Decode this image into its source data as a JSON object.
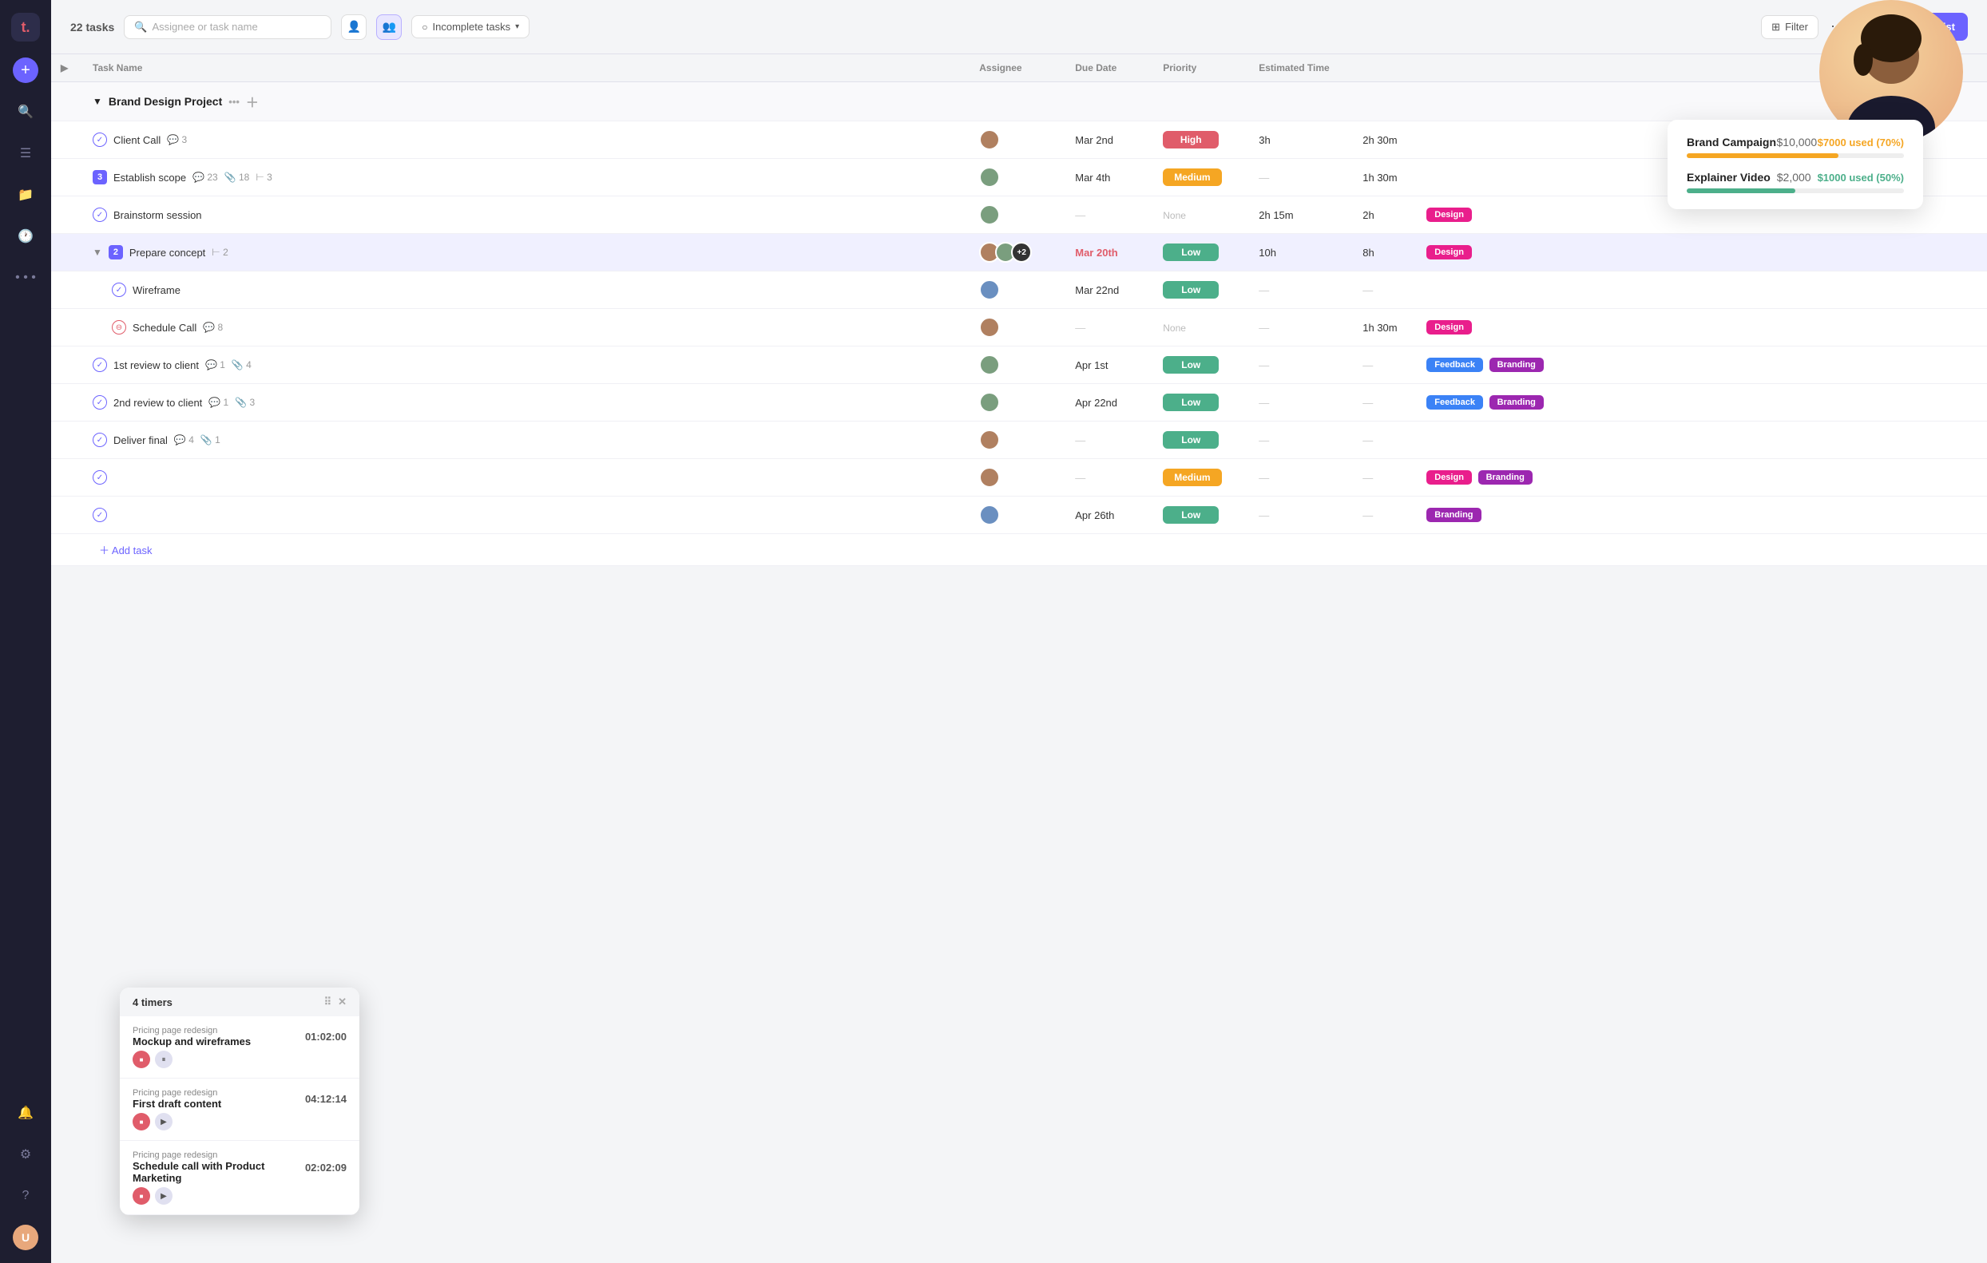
{
  "app": {
    "logo": "t.",
    "task_count": "22 tasks"
  },
  "header": {
    "search_placeholder": "Assignee or task name",
    "filter_label": "Incomplete tasks",
    "add_task_label": "+ Add task list",
    "more_icon": "⋯"
  },
  "budget_popup": {
    "items": [
      {
        "name": "Brand Campaign",
        "total": "$10,000",
        "used_label": "$7000 used",
        "used_pct": "(70%)",
        "bar_pct": 70,
        "bar_color": "yellow"
      },
      {
        "name": "Explainer Video",
        "total": "$2,000",
        "used_label": "$1000 used",
        "used_pct": "(50%)",
        "bar_pct": 50,
        "bar_color": "green"
      }
    ]
  },
  "columns": {
    "task_name": "Task Name",
    "assignee": "Assignee",
    "due_date": "Due Date",
    "priority": "Priority",
    "estimated_time": "Estimated Time",
    "c1": "",
    "c2": ""
  },
  "section": {
    "name": "Brand Design Project"
  },
  "tasks": [
    {
      "id": 1,
      "name": "Client Call",
      "check": "done",
      "comments": 3,
      "assignee_color": "#b08060",
      "due_date": "Mar 2nd",
      "priority": "High",
      "priority_class": "priority-high",
      "est": "3h",
      "time": "2h 30m",
      "tags": []
    },
    {
      "id": 2,
      "name": "Establish scope",
      "check": "expand",
      "expand_num": "3",
      "comments": 23,
      "attachments": 18,
      "subtasks": 3,
      "assignee_color": "#7a9e7e",
      "due_date": "Mar 4th",
      "priority": "Medium",
      "priority_class": "priority-medium",
      "est": "",
      "time": "1h 30m",
      "tags": []
    },
    {
      "id": 3,
      "name": "Brainstorm session",
      "check": "done",
      "assignee_color": "#7a9e7e",
      "due_date": "",
      "priority": "None",
      "priority_class": "priority-none",
      "est": "2h 15m",
      "time": "2h",
      "tags": [
        "Design"
      ]
    },
    {
      "id": 4,
      "name": "Prepare concept",
      "check": "expand-open",
      "expand_num": "2",
      "subtasks": 2,
      "assignee_multi": true,
      "due_date": "Mar 20th",
      "due_date_color": "#e05c6a",
      "priority": "Low",
      "priority_class": "priority-low",
      "est": "10h",
      "time": "8h",
      "tags": [
        "Design"
      ],
      "highlighted": true
    },
    {
      "id": 5,
      "name": "Wireframe",
      "check": "done",
      "assignee_color": "#6a8fc0",
      "due_date": "Mar 22nd",
      "priority": "Low",
      "priority_class": "priority-low",
      "est": "",
      "time": "",
      "tags": [],
      "indent": true
    },
    {
      "id": 6,
      "name": "Schedule Call",
      "check": "blocked",
      "comments": 8,
      "assignee_color": "#b08060",
      "due_date": "",
      "priority": "None",
      "priority_class": "priority-none",
      "est": "",
      "time": "1h 30m",
      "tags": [
        "Design"
      ],
      "indent": true
    },
    {
      "id": 7,
      "name": "1st review to client",
      "check": "done",
      "comments": 1,
      "attachments": 4,
      "assignee_color": "#7a9e7e",
      "due_date": "Apr 1st",
      "priority": "Low",
      "priority_class": "priority-low",
      "est": "",
      "time": "",
      "tags": [
        "Feedback",
        "Branding"
      ]
    },
    {
      "id": 8,
      "name": "2nd review to client",
      "check": "done",
      "comments": 1,
      "attachments": 3,
      "assignee_color": "#7a9e7e",
      "due_date": "Apr 22nd",
      "priority": "Low",
      "priority_class": "priority-low",
      "est": "",
      "time": "",
      "tags": [
        "Feedback",
        "Branding"
      ]
    },
    {
      "id": 9,
      "name": "Deliver final",
      "check": "done",
      "comments": 4,
      "attachments": 1,
      "assignee_color": "#b08060",
      "due_date": "",
      "priority": "Low",
      "priority_class": "priority-low",
      "est": "",
      "time": "",
      "tags": []
    },
    {
      "id": 10,
      "name": "",
      "check": "done",
      "assignee_color": "#b08060",
      "due_date": "",
      "priority": "Medium",
      "priority_class": "priority-medium",
      "est": "",
      "time": "",
      "tags": [
        "Design",
        "Branding"
      ]
    },
    {
      "id": 11,
      "name": "",
      "check": "done",
      "assignee_color": "#6a8fc0",
      "due_date": "Apr 26th",
      "priority": "Low",
      "priority_class": "priority-low",
      "est": "",
      "time": "",
      "tags": [
        "Branding"
      ]
    }
  ],
  "timer_popup": {
    "header": "4 timers",
    "items": [
      {
        "project": "Pricing page redesign",
        "task": "Mockup and wireframes",
        "time": "01:02:00",
        "playing": true
      },
      {
        "project": "Pricing page redesign",
        "task": "First draft content",
        "time": "04:12:14",
        "playing": false
      },
      {
        "project": "Pricing page redesign",
        "task": "Schedule call with Product Marketing",
        "time": "02:02:09",
        "playing": false
      }
    ]
  },
  "sidebar": {
    "items": [
      {
        "icon": "🔍",
        "name": "search"
      },
      {
        "icon": "☰",
        "name": "list"
      },
      {
        "icon": "📁",
        "name": "folder"
      },
      {
        "icon": "🕐",
        "name": "time"
      },
      {
        "icon": "⋯",
        "name": "more"
      },
      {
        "icon": "🔔",
        "name": "notifications"
      },
      {
        "icon": "⚙",
        "name": "settings"
      },
      {
        "icon": "?",
        "name": "help"
      }
    ]
  },
  "colors": {
    "sidebar_bg": "#1e1e30",
    "accent": "#6c63ff",
    "danger": "#e05c6a",
    "warning": "#f5a623",
    "success": "#4caf8a"
  }
}
